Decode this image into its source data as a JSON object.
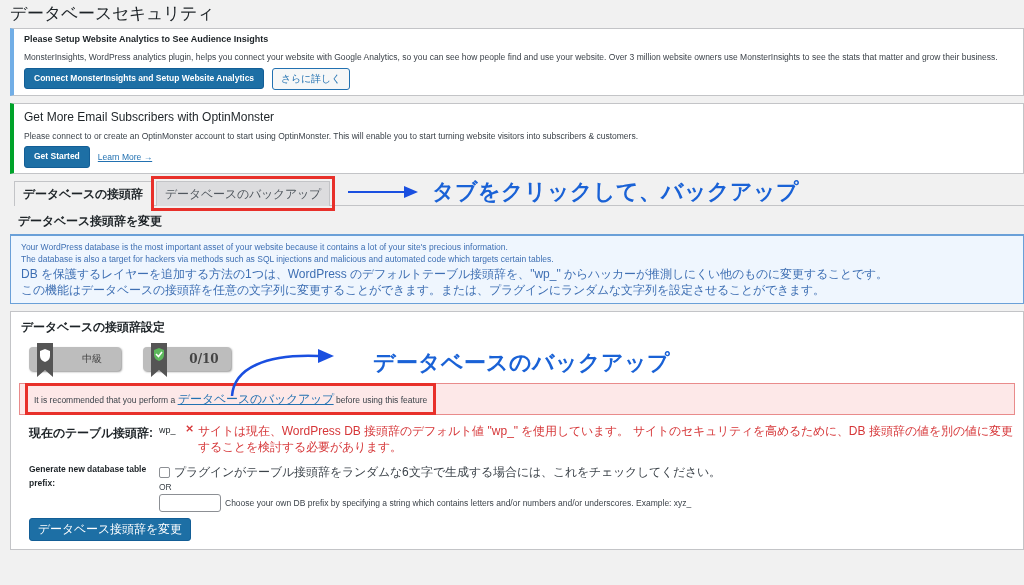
{
  "page_title": "データベースセキュリティ",
  "notices": [
    {
      "kind": "analytics",
      "title": "Please Setup Website Analytics to See Audience Insights",
      "text": "MonsterInsights, WordPress analytics plugin, helps you connect your website with Google Analytics, so you can see how people find and use your website. Over 3 million website owners use MonsterInsights to see the stats that matter and grow their business.",
      "buttons": [
        {
          "label": "Connect MonsterInsights and Setup Website Analytics",
          "kind": "primary"
        },
        {
          "label": "さらに詳しく",
          "kind": "secondary"
        }
      ]
    },
    {
      "kind": "optin",
      "title": "Get More Email Subscribers with OptinMonster",
      "text": "Please connect to or create an OptinMonster account to start using OptinMonster. This will enable you to start turning website visitors into subscribers & customers.",
      "buttons": [
        {
          "label": "Get Started",
          "kind": "primary"
        },
        {
          "label": "Learn More →",
          "kind": "link"
        }
      ]
    }
  ],
  "tabs": [
    {
      "label": "データベースの接頭辞",
      "selected": true,
      "highlighted": false
    },
    {
      "label": "データベースのバックアップ",
      "selected": false,
      "highlighted": true
    }
  ],
  "annotations": [
    {
      "text": "タブをクリックして、バックアップ"
    },
    {
      "text": "データベースのバックアップ"
    }
  ],
  "section_title": "データベース接頭辞を変更",
  "info_lines": [
    "Your WordPress database is the most important asset of your website because it contains a lot of your site's precious information.",
    "The database is also a target for hackers via methods such as SQL injections and malicious and automated code which targets certain tables.",
    "DB を保護するレイヤーを追加する方法の1つは、WordPress のデフォルトテーブル接頭辞を、\"wp_\" からハッカーが推測しにくい他のものに変更することです。",
    "この機能はデータベースの接頭辞を任意の文字列に変更することができます。または、プラグインにランダムな文字列を設定させることができます。"
  ],
  "settings": {
    "title": "データベースの接頭辞設定",
    "badges": [
      {
        "kind": "shield",
        "label": "中級"
      },
      {
        "kind": "check",
        "label": "0/10"
      }
    ],
    "warning": {
      "before": "It is recommended that you perform a",
      "link": "データベースのバックアップ",
      "after": "before using this feature",
      "highlighted": true
    },
    "current_prefix": {
      "label": "現在のテーブル接頭辞:",
      "value": "wp_",
      "message": "サイトは現在、WordPress DB 接頭辞のデフォルト値 \"wp_\" を使用しています。 サイトのセキュリティを高めるために、DB 接頭辞の値を別の値に変更することを検討する必要があります。"
    },
    "new_prefix": {
      "label": "Generate new database table prefix:",
      "checkbox_label": "プラグインがテーブル接頭辞をランダムな6文字で生成する場合には、これをチェックしてください。",
      "checked": false,
      "or": "OR",
      "custom_hint": "Choose your own DB prefix by specifying a string which contains letters and/or numbers and/or underscores. Example: xyz_"
    },
    "submit": "データベース接頭辞を変更"
  }
}
